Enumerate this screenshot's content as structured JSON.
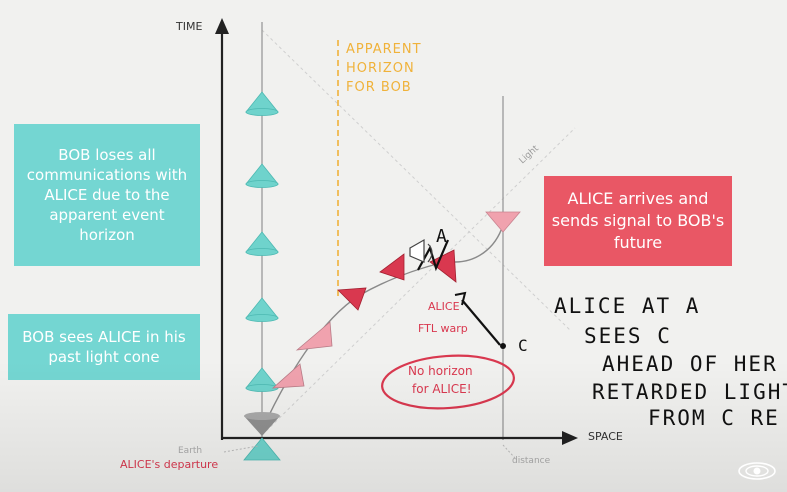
{
  "axes": {
    "time_label": "TIME",
    "space_label": "SPACE"
  },
  "horizon": {
    "lines": [
      "APPARENT",
      "HORIZON",
      "FOR BOB"
    ],
    "color": "#f0b23a"
  },
  "light_label": "Light",
  "earth_label": "Earth",
  "distance_label": "distance",
  "departure_label": "ALICE's departure",
  "boxes": {
    "bob_loses": "BOB loses all communications with ALICE due to the apparent event horizon",
    "bob_sees": "BOB sees ALICE in his past light cone",
    "alice_arrives": "ALICE arrives and sends signal to BOB's future"
  },
  "annotations": {
    "ftl_line1": "ALICE",
    "ftl_line2": "FTL warp",
    "no_horizon_line1": "No horizon",
    "no_horizon_line2": "for ALICE!",
    "point_a": "A",
    "point_c": "C"
  },
  "handwriting": {
    "line1": "ALICE AT A",
    "line2": "SEES C",
    "line3": "AHEAD OF HER",
    "line4": "RETARDED LIGHT",
    "line5": "FROM C RE"
  },
  "colors": {
    "teal": "#74d6d2",
    "red": "#e95765",
    "cone_teal": "#6fd3cc",
    "cone_red": "#d9384f",
    "cone_pink": "#f0a2ae"
  }
}
